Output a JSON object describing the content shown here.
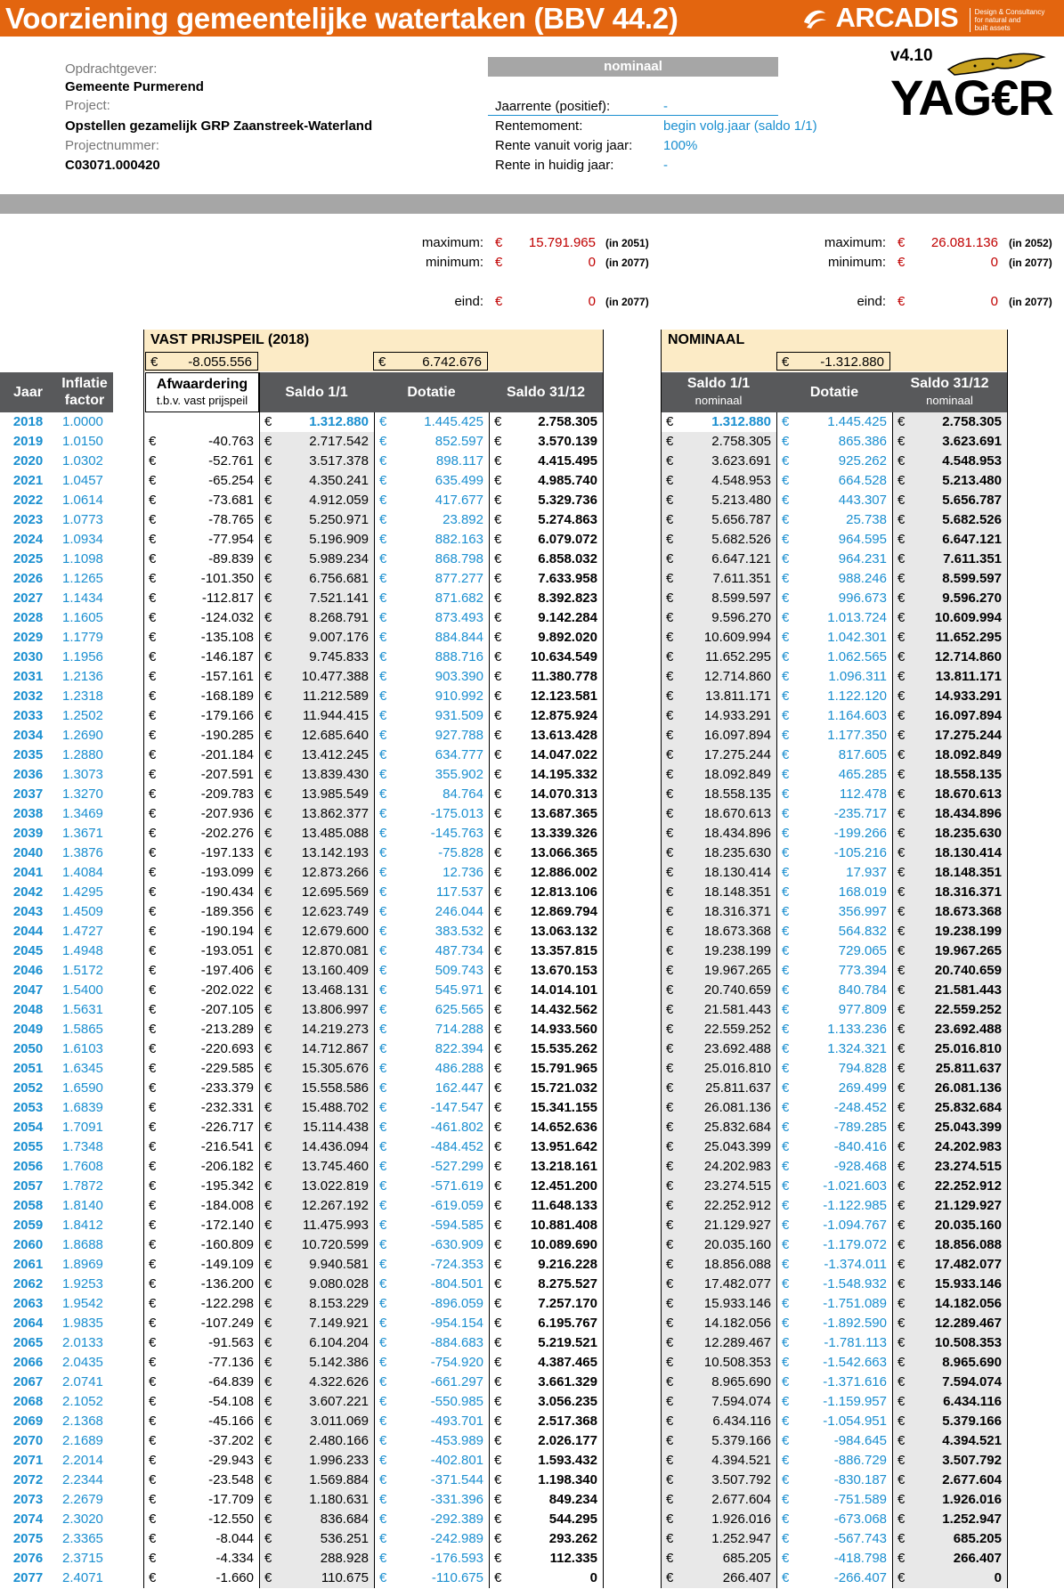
{
  "header": {
    "title": "Voorziening gemeentelijke watertaken (BBV 44.2)",
    "logo_text": "ARCADIS",
    "logo_tagline": [
      "Design & Consultancy",
      "for natural and",
      "built assets"
    ]
  },
  "info": {
    "client_label": "Opdrachtgever:",
    "client": "Gemeente Purmerend",
    "project_label": "Project:",
    "project": "Opstellen gezamelijk GRP Zaanstreek-Waterland",
    "projnr_label": "Projectnummer:",
    "projnr": "C03071.000420"
  },
  "settings": {
    "mode": "nominaal",
    "items": [
      {
        "label": "Jaarrente (positief):",
        "value": "-"
      },
      {
        "label": "Rentemoment:",
        "value": "begin volg.jaar (saldo 1/1)"
      },
      {
        "label": "Rente vanuit vorig jaar:",
        "value": "100%"
      },
      {
        "label": "Rente in huidig jaar:",
        "value": "-"
      }
    ]
  },
  "brand": {
    "version": "v4.10",
    "product": "YAG€R"
  },
  "summary": {
    "currency": "€",
    "left": {
      "max_label": "maximum:",
      "max_value": "15.791.965",
      "max_year": "(in 2051)",
      "min_label": "minimum:",
      "min_value": "0",
      "min_year": "(in 2077)",
      "end_label": "eind:",
      "end_value": "0",
      "end_year": "(in 2077)"
    },
    "right": {
      "max_label": "maximum:",
      "max_value": "26.081.136",
      "max_year": "(in 2052)",
      "min_label": "minimum:",
      "min_value": "0",
      "min_year": "(in 2077)",
      "end_label": "eind:",
      "end_value": "0",
      "end_year": "(in 2077)"
    }
  },
  "table": {
    "vast_title": "VAST PRIJSPEIL (2018)",
    "nominaal_title": "NOMINAAL",
    "vast_total_afw": "-8.055.556",
    "vast_total_dot": "6.742.676",
    "nom_total_dot": "-1.312.880",
    "col_jaar": "Jaar",
    "col_infl": [
      "Inflatie",
      "factor"
    ],
    "col_afw": "Afwaardering",
    "col_afw_sub": "t.b.v. vast prijspeil",
    "col_saldo11": "Saldo 1/1",
    "col_dot": "Dotatie",
    "col_saldo3112": "Saldo 31/12",
    "col_nom_saldo11": "Saldo 1/1",
    "col_nom_sub": "nominaal",
    "col_nom_dot": "Dotatie",
    "col_nom_saldo3112": "Saldo 31/12",
    "col_nom_sub2": "nominaal",
    "currency": "€",
    "rows": [
      [
        "2018",
        "1.0000",
        "",
        "1.312.880",
        "1.445.425",
        "2.758.305",
        "1.312.880",
        "1.445.425",
        "2.758.305"
      ],
      [
        "2019",
        "1.0150",
        "-40.763",
        "2.717.542",
        "852.597",
        "3.570.139",
        "2.758.305",
        "865.386",
        "3.623.691"
      ],
      [
        "2020",
        "1.0302",
        "-52.761",
        "3.517.378",
        "898.117",
        "4.415.495",
        "3.623.691",
        "925.262",
        "4.548.953"
      ],
      [
        "2021",
        "1.0457",
        "-65.254",
        "4.350.241",
        "635.499",
        "4.985.740",
        "4.548.953",
        "664.528",
        "5.213.480"
      ],
      [
        "2022",
        "1.0614",
        "-73.681",
        "4.912.059",
        "417.677",
        "5.329.736",
        "5.213.480",
        "443.307",
        "5.656.787"
      ],
      [
        "2023",
        "1.0773",
        "-78.765",
        "5.250.971",
        "23.892",
        "5.274.863",
        "5.656.787",
        "25.738",
        "5.682.526"
      ],
      [
        "2024",
        "1.0934",
        "-77.954",
        "5.196.909",
        "882.163",
        "6.079.072",
        "5.682.526",
        "964.595",
        "6.647.121"
      ],
      [
        "2025",
        "1.1098",
        "-89.839",
        "5.989.234",
        "868.798",
        "6.858.032",
        "6.647.121",
        "964.231",
        "7.611.351"
      ],
      [
        "2026",
        "1.1265",
        "-101.350",
        "6.756.681",
        "877.277",
        "7.633.958",
        "7.611.351",
        "988.246",
        "8.599.597"
      ],
      [
        "2027",
        "1.1434",
        "-112.817",
        "7.521.141",
        "871.682",
        "8.392.823",
        "8.599.597",
        "996.673",
        "9.596.270"
      ],
      [
        "2028",
        "1.1605",
        "-124.032",
        "8.268.791",
        "873.493",
        "9.142.284",
        "9.596.270",
        "1.013.724",
        "10.609.994"
      ],
      [
        "2029",
        "1.1779",
        "-135.108",
        "9.007.176",
        "884.844",
        "9.892.020",
        "10.609.994",
        "1.042.301",
        "11.652.295"
      ],
      [
        "2030",
        "1.1956",
        "-146.187",
        "9.745.833",
        "888.716",
        "10.634.549",
        "11.652.295",
        "1.062.565",
        "12.714.860"
      ],
      [
        "2031",
        "1.2136",
        "-157.161",
        "10.477.388",
        "903.390",
        "11.380.778",
        "12.714.860",
        "1.096.311",
        "13.811.171"
      ],
      [
        "2032",
        "1.2318",
        "-168.189",
        "11.212.589",
        "910.992",
        "12.123.581",
        "13.811.171",
        "1.122.120",
        "14.933.291"
      ],
      [
        "2033",
        "1.2502",
        "-179.166",
        "11.944.415",
        "931.509",
        "12.875.924",
        "14.933.291",
        "1.164.603",
        "16.097.894"
      ],
      [
        "2034",
        "1.2690",
        "-190.285",
        "12.685.640",
        "927.788",
        "13.613.428",
        "16.097.894",
        "1.177.350",
        "17.275.244"
      ],
      [
        "2035",
        "1.2880",
        "-201.184",
        "13.412.245",
        "634.777",
        "14.047.022",
        "17.275.244",
        "817.605",
        "18.092.849"
      ],
      [
        "2036",
        "1.3073",
        "-207.591",
        "13.839.430",
        "355.902",
        "14.195.332",
        "18.092.849",
        "465.285",
        "18.558.135"
      ],
      [
        "2037",
        "1.3270",
        "-209.783",
        "13.985.549",
        "84.764",
        "14.070.313",
        "18.558.135",
        "112.478",
        "18.670.613"
      ],
      [
        "2038",
        "1.3469",
        "-207.936",
        "13.862.377",
        "-175.013",
        "13.687.365",
        "18.670.613",
        "-235.717",
        "18.434.896"
      ],
      [
        "2039",
        "1.3671",
        "-202.276",
        "13.485.088",
        "-145.763",
        "13.339.326",
        "18.434.896",
        "-199.266",
        "18.235.630"
      ],
      [
        "2040",
        "1.3876",
        "-197.133",
        "13.142.193",
        "-75.828",
        "13.066.365",
        "18.235.630",
        "-105.216",
        "18.130.414"
      ],
      [
        "2041",
        "1.4084",
        "-193.099",
        "12.873.266",
        "12.736",
        "12.886.002",
        "18.130.414",
        "17.937",
        "18.148.351"
      ],
      [
        "2042",
        "1.4295",
        "-190.434",
        "12.695.569",
        "117.537",
        "12.813.106",
        "18.148.351",
        "168.019",
        "18.316.371"
      ],
      [
        "2043",
        "1.4509",
        "-189.356",
        "12.623.749",
        "246.044",
        "12.869.794",
        "18.316.371",
        "356.997",
        "18.673.368"
      ],
      [
        "2044",
        "1.4727",
        "-190.194",
        "12.679.600",
        "383.532",
        "13.063.132",
        "18.673.368",
        "564.832",
        "19.238.199"
      ],
      [
        "2045",
        "1.4948",
        "-193.051",
        "12.870.081",
        "487.734",
        "13.357.815",
        "19.238.199",
        "729.065",
        "19.967.265"
      ],
      [
        "2046",
        "1.5172",
        "-197.406",
        "13.160.409",
        "509.743",
        "13.670.153",
        "19.967.265",
        "773.394",
        "20.740.659"
      ],
      [
        "2047",
        "1.5400",
        "-202.022",
        "13.468.131",
        "545.971",
        "14.014.101",
        "20.740.659",
        "840.784",
        "21.581.443"
      ],
      [
        "2048",
        "1.5631",
        "-207.105",
        "13.806.997",
        "625.565",
        "14.432.562",
        "21.581.443",
        "977.809",
        "22.559.252"
      ],
      [
        "2049",
        "1.5865",
        "-213.289",
        "14.219.273",
        "714.288",
        "14.933.560",
        "22.559.252",
        "1.133.236",
        "23.692.488"
      ],
      [
        "2050",
        "1.6103",
        "-220.693",
        "14.712.867",
        "822.394",
        "15.535.262",
        "23.692.488",
        "1.324.321",
        "25.016.810"
      ],
      [
        "2051",
        "1.6345",
        "-229.585",
        "15.305.676",
        "486.288",
        "15.791.965",
        "25.016.810",
        "794.828",
        "25.811.637"
      ],
      [
        "2052",
        "1.6590",
        "-233.379",
        "15.558.586",
        "162.447",
        "15.721.032",
        "25.811.637",
        "269.499",
        "26.081.136"
      ],
      [
        "2053",
        "1.6839",
        "-232.331",
        "15.488.702",
        "-147.547",
        "15.341.155",
        "26.081.136",
        "-248.452",
        "25.832.684"
      ],
      [
        "2054",
        "1.7091",
        "-226.717",
        "15.114.438",
        "-461.802",
        "14.652.636",
        "25.832.684",
        "-789.285",
        "25.043.399"
      ],
      [
        "2055",
        "1.7348",
        "-216.541",
        "14.436.094",
        "-484.452",
        "13.951.642",
        "25.043.399",
        "-840.416",
        "24.202.983"
      ],
      [
        "2056",
        "1.7608",
        "-206.182",
        "13.745.460",
        "-527.299",
        "13.218.161",
        "24.202.983",
        "-928.468",
        "23.274.515"
      ],
      [
        "2057",
        "1.7872",
        "-195.342",
        "13.022.819",
        "-571.619",
        "12.451.200",
        "23.274.515",
        "-1.021.603",
        "22.252.912"
      ],
      [
        "2058",
        "1.8140",
        "-184.008",
        "12.267.192",
        "-619.059",
        "11.648.133",
        "22.252.912",
        "-1.122.985",
        "21.129.927"
      ],
      [
        "2059",
        "1.8412",
        "-172.140",
        "11.475.993",
        "-594.585",
        "10.881.408",
        "21.129.927",
        "-1.094.767",
        "20.035.160"
      ],
      [
        "2060",
        "1.8688",
        "-160.809",
        "10.720.599",
        "-630.909",
        "10.089.690",
        "20.035.160",
        "-1.179.072",
        "18.856.088"
      ],
      [
        "2061",
        "1.8969",
        "-149.109",
        "9.940.581",
        "-724.353",
        "9.216.228",
        "18.856.088",
        "-1.374.011",
        "17.482.077"
      ],
      [
        "2062",
        "1.9253",
        "-136.200",
        "9.080.028",
        "-804.501",
        "8.275.527",
        "17.482.077",
        "-1.548.932",
        "15.933.146"
      ],
      [
        "2063",
        "1.9542",
        "-122.298",
        "8.153.229",
        "-896.059",
        "7.257.170",
        "15.933.146",
        "-1.751.089",
        "14.182.056"
      ],
      [
        "2064",
        "1.9835",
        "-107.249",
        "7.149.921",
        "-954.154",
        "6.195.767",
        "14.182.056",
        "-1.892.590",
        "12.289.467"
      ],
      [
        "2065",
        "2.0133",
        "-91.563",
        "6.104.204",
        "-884.683",
        "5.219.521",
        "12.289.467",
        "-1.781.113",
        "10.508.353"
      ],
      [
        "2066",
        "2.0435",
        "-77.136",
        "5.142.386",
        "-754.920",
        "4.387.465",
        "10.508.353",
        "-1.542.663",
        "8.965.690"
      ],
      [
        "2067",
        "2.0741",
        "-64.839",
        "4.322.626",
        "-661.297",
        "3.661.329",
        "8.965.690",
        "-1.371.616",
        "7.594.074"
      ],
      [
        "2068",
        "2.1052",
        "-54.108",
        "3.607.221",
        "-550.985",
        "3.056.235",
        "7.594.074",
        "-1.159.957",
        "6.434.116"
      ],
      [
        "2069",
        "2.1368",
        "-45.166",
        "3.011.069",
        "-493.701",
        "2.517.368",
        "6.434.116",
        "-1.054.951",
        "5.379.166"
      ],
      [
        "2070",
        "2.1689",
        "-37.202",
        "2.480.166",
        "-453.989",
        "2.026.177",
        "5.379.166",
        "-984.645",
        "4.394.521"
      ],
      [
        "2071",
        "2.2014",
        "-29.943",
        "1.996.233",
        "-402.801",
        "1.593.432",
        "4.394.521",
        "-886.729",
        "3.507.792"
      ],
      [
        "2072",
        "2.2344",
        "-23.548",
        "1.569.884",
        "-371.544",
        "1.198.340",
        "3.507.792",
        "-830.187",
        "2.677.604"
      ],
      [
        "2073",
        "2.2679",
        "-17.709",
        "1.180.631",
        "-331.396",
        "849.234",
        "2.677.604",
        "-751.589",
        "1.926.016"
      ],
      [
        "2074",
        "2.3020",
        "-12.550",
        "836.684",
        "-292.389",
        "544.295",
        "1.926.016",
        "-673.068",
        "1.252.947"
      ],
      [
        "2075",
        "2.3365",
        "-8.044",
        "536.251",
        "-242.989",
        "293.262",
        "1.252.947",
        "-567.743",
        "685.205"
      ],
      [
        "2076",
        "2.3715",
        "-4.334",
        "288.928",
        "-176.593",
        "112.335",
        "685.205",
        "-418.798",
        "266.407"
      ],
      [
        "2077",
        "2.4071",
        "-1.660",
        "110.675",
        "-110.675",
        "0",
        "266.407",
        "-266.407",
        "0"
      ]
    ]
  }
}
